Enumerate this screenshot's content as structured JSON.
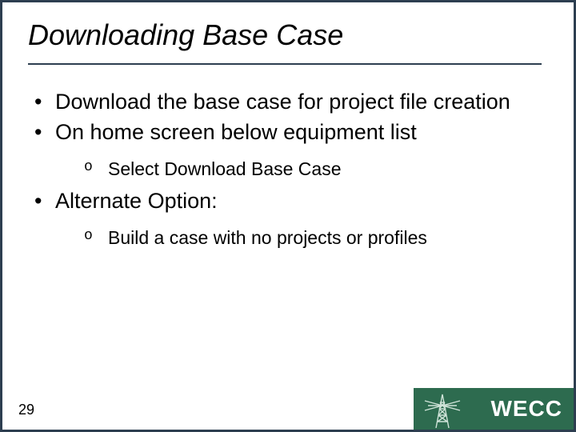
{
  "title": "Downloading Base Case",
  "bullets": {
    "b1": "Download the base case for project file creation",
    "b2": "On home screen below equipment list",
    "b2_sub1": "Select Download Base Case",
    "b3": "Alternate Option:",
    "b3_sub1": "Build a case with no projects or profiles"
  },
  "page_number": "29",
  "logo_text": "WECC"
}
